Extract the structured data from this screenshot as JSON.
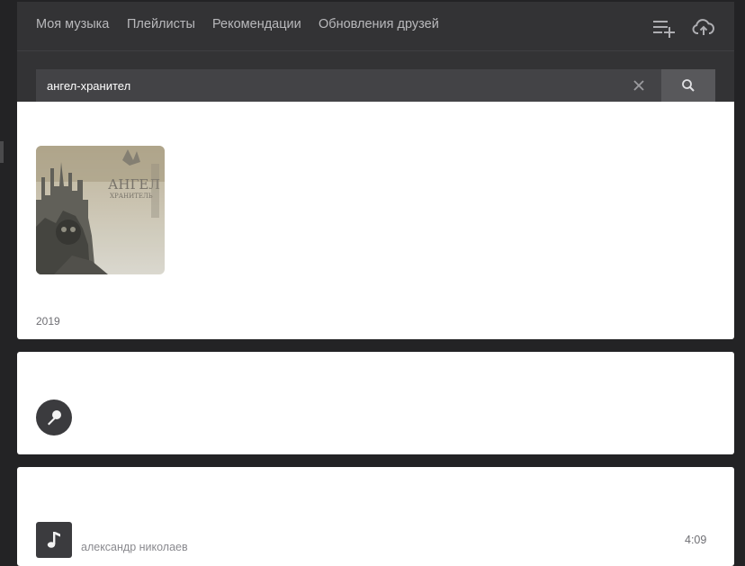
{
  "nav": {
    "items": [
      {
        "label": "Моя музыка"
      },
      {
        "label": "Плейлисты"
      },
      {
        "label": "Рекомендации"
      },
      {
        "label": "Обновления друзей"
      }
    ],
    "icons": [
      "add-to-playlist-icon",
      "cloud-upload-icon"
    ]
  },
  "search": {
    "value": "ангел-хранител",
    "clear_icon": "close-icon",
    "button_icon": "search-icon"
  },
  "album": {
    "year": "2019",
    "cover_title_art": "АНГЕЛ ХРАНИТЕЛЬ"
  },
  "artist": {
    "icon": "microphone-icon"
  },
  "track": {
    "artist": "александр николаев",
    "duration": "4:09",
    "icon": "music-note-icon"
  },
  "colors": {
    "background": "#232325",
    "panel": "#333335",
    "search_field": "#434346",
    "search_button": "#58585b",
    "card": "#ffffff"
  }
}
